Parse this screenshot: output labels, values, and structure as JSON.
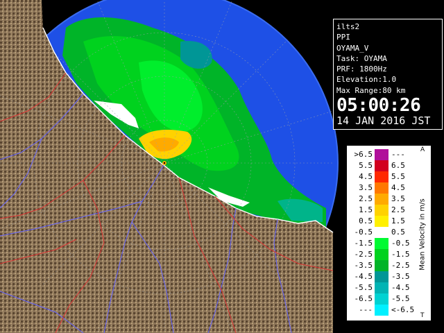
{
  "info": {
    "lines": [
      "ilts2",
      "PPI",
      "OYAMA_V",
      "Task: OYAMA",
      "PRF: 1800Hz",
      "Elevation:1.0",
      "Max Range:80 km"
    ],
    "time": "05:00:26",
    "date": "14 JAN 2016 JST"
  },
  "legend": {
    "unit_label": "Mean Velocity in m/s",
    "top_marker": "A",
    "bottom_marker": "T",
    "rows": [
      {
        "lo": ">6.5",
        "hi": "---",
        "color": "#b0109a"
      },
      {
        "lo": "5.5",
        "hi": "6.5",
        "color": "#d2001e"
      },
      {
        "lo": "4.5",
        "hi": "5.5",
        "color": "#ff2800"
      },
      {
        "lo": "3.5",
        "hi": "4.5",
        "color": "#ff7800"
      },
      {
        "lo": "2.5",
        "hi": "3.5",
        "color": "#ffaa00"
      },
      {
        "lo": "1.5",
        "hi": "2.5",
        "color": "#ffd200"
      },
      {
        "lo": "0.5",
        "hi": "1.5",
        "color": "#fff000"
      },
      {
        "lo": "-0.5",
        "hi": "0.5",
        "color": "#ffffff"
      },
      {
        "lo": "-1.5",
        "hi": "-0.5",
        "color": "#00fa32"
      },
      {
        "lo": "-2.5",
        "hi": "-1.5",
        "color": "#00d21e"
      },
      {
        "lo": "-3.5",
        "hi": "-2.5",
        "color": "#00b428"
      },
      {
        "lo": "-4.5",
        "hi": "-3.5",
        "color": "#009696"
      },
      {
        "lo": "-5.5",
        "hi": "-4.5",
        "color": "#00b4b4"
      },
      {
        "lo": "-6.5",
        "hi": "-5.5",
        "color": "#00d2d2"
      },
      {
        "lo": "---",
        "hi": "<-6.5",
        "color": "#00f0ff"
      }
    ]
  },
  "colors": {
    "background": "#000000",
    "no_echo_area": "#1e50e6",
    "outer_range": "#0064ff",
    "terrain": "#8a7050",
    "rivers": "#6464ff",
    "boundaries": "#dc3232"
  }
}
